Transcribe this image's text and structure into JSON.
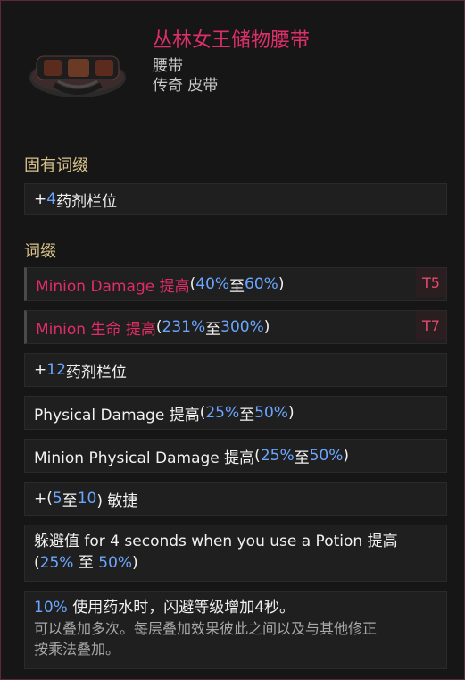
{
  "item": {
    "name": "丛林女王储物腰带",
    "type_line_1": "腰带",
    "type_line_2": "传奇 皮带",
    "art_icon": "belt-icon"
  },
  "sections": {
    "implicit_title": "固有词缀",
    "affixes_title": "词缀"
  },
  "implicit": {
    "prefix": "+",
    "num": "4",
    "suffix": " 药剂栏位"
  },
  "affixes": [
    {
      "parts": [
        {
          "text": "Minion Damage 提高",
          "style": "pink"
        },
        {
          "text": " (",
          "style": "main"
        },
        {
          "text": "40%",
          "style": "num"
        },
        {
          "text": " 至 ",
          "style": "main"
        },
        {
          "text": "60%",
          "style": "num"
        },
        {
          "text": ")",
          "style": "main"
        }
      ],
      "tier": "T5"
    },
    {
      "parts": [
        {
          "text": "Minion 生命 提高",
          "style": "pink"
        },
        {
          "text": " (",
          "style": "main"
        },
        {
          "text": "231%",
          "style": "num"
        },
        {
          "text": " 至 ",
          "style": "main"
        },
        {
          "text": "300%",
          "style": "num"
        },
        {
          "text": ")",
          "style": "main"
        }
      ],
      "tier": "T7"
    },
    {
      "parts": [
        {
          "text": "+",
          "style": "main"
        },
        {
          "text": "12",
          "style": "num"
        },
        {
          "text": " 药剂栏位",
          "style": "main"
        }
      ]
    },
    {
      "parts": [
        {
          "text": "Physical Damage 提高 ",
          "style": "main"
        },
        {
          "text": "(",
          "style": "main"
        },
        {
          "text": "25%",
          "style": "num"
        },
        {
          "text": " 至 ",
          "style": "main"
        },
        {
          "text": "50%",
          "style": "num"
        },
        {
          "text": ")",
          "style": "main"
        }
      ]
    },
    {
      "parts": [
        {
          "text": "Minion Physical Damage 提高 ",
          "style": "main"
        },
        {
          "text": "(",
          "style": "main"
        },
        {
          "text": "25%",
          "style": "num"
        },
        {
          "text": " 至 ",
          "style": "main"
        },
        {
          "text": "50%",
          "style": "num"
        },
        {
          "text": ")",
          "style": "main"
        }
      ]
    },
    {
      "parts": [
        {
          "text": "+(",
          "style": "main"
        },
        {
          "text": "5",
          "style": "num"
        },
        {
          "text": " 至 ",
          "style": "main"
        },
        {
          "text": "10",
          "style": "num"
        },
        {
          "text": ") 敏捷",
          "style": "main"
        }
      ]
    }
  ],
  "affix_dodge": {
    "line1": "躲避值 for 4 seconds when you use a Potion 提高",
    "line2_open": "(",
    "line2_a": "25%",
    "line2_mid": " 至 ",
    "line2_b": "50%",
    "line2_close": ")"
  },
  "affix_unique": {
    "num": "10%",
    "text": " 使用药水时，闪避等级增加4秒。",
    "desc1": "可以叠加多次。每层叠加效果彼此之间以及与其他修正",
    "desc2": "按乘法叠加。"
  }
}
